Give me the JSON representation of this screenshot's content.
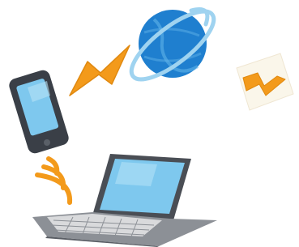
{
  "illustration": {
    "icons": [
      "smartphone-icon",
      "lightning-bolt-icon",
      "globe-icon",
      "lightning-bolt-icon",
      "wireless-signal-icon",
      "laptop-icon"
    ],
    "colors": {
      "device_body": "#3a3f47",
      "screen_blue": "#7ec8ee",
      "screen_highlight": "#b7e3f7",
      "bolt_orange": "#f39a1b",
      "bolt_tile_bg": "#faf6ea",
      "globe_blue": "#1f7fcf",
      "globe_ring": "#9fd3f0",
      "laptop_gray": "#8c9096",
      "laptop_dark": "#4a4e55",
      "keyboard_light": "#d9dadc"
    }
  }
}
